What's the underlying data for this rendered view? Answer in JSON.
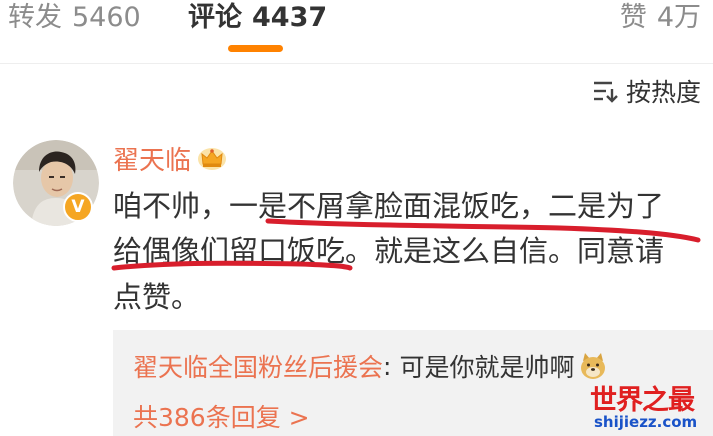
{
  "tabs": [
    {
      "label": "转发",
      "count": "5460"
    },
    {
      "label": "评论",
      "count": "4437"
    },
    {
      "label": "赞",
      "count": "4万"
    }
  ],
  "sort": {
    "label": "按热度",
    "icon": "sort-lines-icon"
  },
  "comment": {
    "username": "翟天临",
    "user_badge_icon": "crown-icon",
    "verified_mark": "V",
    "lines": [
      "咱不帅，一是不屑拿脸面混饭吃，二是为了",
      "给偶像们留口饭吃。就是这么自信。同意请",
      "点赞。"
    ]
  },
  "replies": {
    "author": "翟天临全国粉丝后援会",
    "separator": ":",
    "text": "可是你就是帅啊",
    "emoji_icon": "doge-icon",
    "more": "共386条回复 >"
  },
  "watermark": {
    "title": "世界之最",
    "domain": "shijiezz.com"
  },
  "colors": {
    "accent_orange": "#ff8200",
    "username_orange": "#eb7350",
    "underline_red": "#d81e2c",
    "reply_bg": "#f2f2f2"
  }
}
